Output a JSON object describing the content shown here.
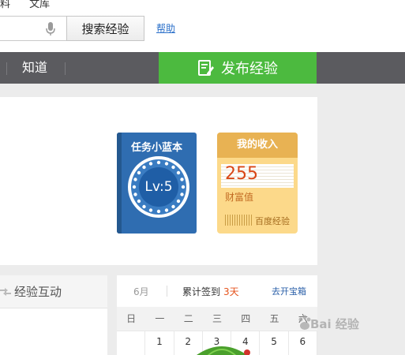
{
  "top": {
    "links": [
      "料",
      "文库"
    ],
    "search_button": "搜索经验",
    "help": "帮助",
    "icons": {
      "mic": "microphone-icon"
    }
  },
  "nav": {
    "item": "知道",
    "publish": "发布经验",
    "colors": {
      "bar": "#5b5b5f",
      "publish": "#4cba3f"
    }
  },
  "task_book": {
    "title": "任务小蓝本",
    "level": "Lv:5",
    "color": "#2f6db1"
  },
  "income": {
    "title": "我的收入",
    "value": "255",
    "label": "财富值",
    "brand": "百度经验",
    "color": "#fcd98a"
  },
  "interact": {
    "label": "经验互动"
  },
  "calendar": {
    "month": "6月",
    "streak_label": "累计签到",
    "streak_days": "3天",
    "open_chest": "去开宝箱",
    "weekdays": [
      "日",
      "一",
      "二",
      "三",
      "四",
      "五",
      "六"
    ],
    "days": [
      "",
      "1",
      "2",
      "3",
      "4",
      "5",
      "6"
    ]
  },
  "watermark": "Bai 经验"
}
